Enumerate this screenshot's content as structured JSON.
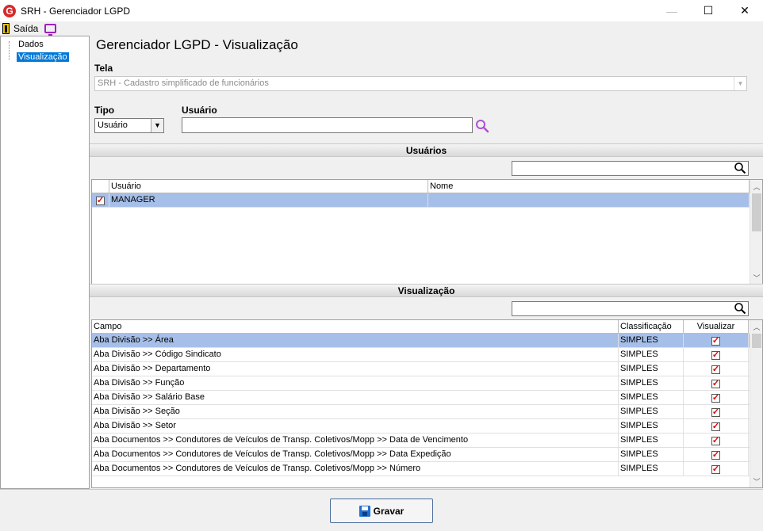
{
  "window": {
    "title": "SRH - Gerenciador LGPD",
    "logo_letter": "G",
    "minimize": "—",
    "maximize": "☐",
    "close": "✕"
  },
  "menu": {
    "exit_label": "Saída"
  },
  "tree": {
    "items": [
      {
        "label": "Dados",
        "selected": false
      },
      {
        "label": "Visualização",
        "selected": true
      }
    ]
  },
  "main": {
    "title": "Gerenciador LGPD - Visualização",
    "tela_label": "Tela",
    "tela_value": "SRH - Cadastro simplificado de funcionários",
    "tipo_label": "Tipo",
    "tipo_value": "Usuário",
    "usuario_label": "Usuário",
    "usuario_value": "",
    "dropdown_arrow": "▼"
  },
  "users_section": {
    "header": "Usuários",
    "filter_value": "",
    "columns": [
      "",
      "Usuário",
      "Nome"
    ],
    "rows": [
      {
        "checked": true,
        "usuario": "MANAGER",
        "nome": "",
        "selected": true
      }
    ]
  },
  "view_section": {
    "header": "Visualização",
    "filter_value": "",
    "columns": [
      "Campo",
      "Classificação",
      "Visualizar"
    ],
    "rows": [
      {
        "campo": "Aba Divisão >> Área",
        "classificacao": "SIMPLES",
        "visualizar": true,
        "selected": true
      },
      {
        "campo": "Aba Divisão >> Código Sindicato",
        "classificacao": "SIMPLES",
        "visualizar": true,
        "selected": false
      },
      {
        "campo": "Aba Divisão >> Departamento",
        "classificacao": "SIMPLES",
        "visualizar": true,
        "selected": false
      },
      {
        "campo": "Aba Divisão >> Função",
        "classificacao": "SIMPLES",
        "visualizar": true,
        "selected": false
      },
      {
        "campo": "Aba Divisão >> Salário Base",
        "classificacao": "SIMPLES",
        "visualizar": true,
        "selected": false
      },
      {
        "campo": "Aba Divisão >> Seção",
        "classificacao": "SIMPLES",
        "visualizar": true,
        "selected": false
      },
      {
        "campo": "Aba Divisão >> Setor",
        "classificacao": "SIMPLES",
        "visualizar": true,
        "selected": false
      },
      {
        "campo": "Aba Documentos >>  Condutores de Veículos de Transp. Coletivos/Mopp >> Data de Vencimento",
        "classificacao": "SIMPLES",
        "visualizar": true,
        "selected": false
      },
      {
        "campo": "Aba Documentos >>  Condutores de Veículos de Transp. Coletivos/Mopp >> Data Expedição",
        "classificacao": "SIMPLES",
        "visualizar": true,
        "selected": false
      },
      {
        "campo": "Aba Documentos >>  Condutores de Veículos de Transp. Coletivos/Mopp >> Número",
        "classificacao": "SIMPLES",
        "visualizar": true,
        "selected": false
      }
    ]
  },
  "footer": {
    "save_label": "Gravar"
  },
  "scroll": {
    "up": "︿",
    "down": "﹀"
  },
  "colors": {
    "selection_row": "#a6bfe8",
    "tree_selection": "#0078d7",
    "check_red": "#e00000",
    "lookup_purple": "#b04fd6"
  }
}
